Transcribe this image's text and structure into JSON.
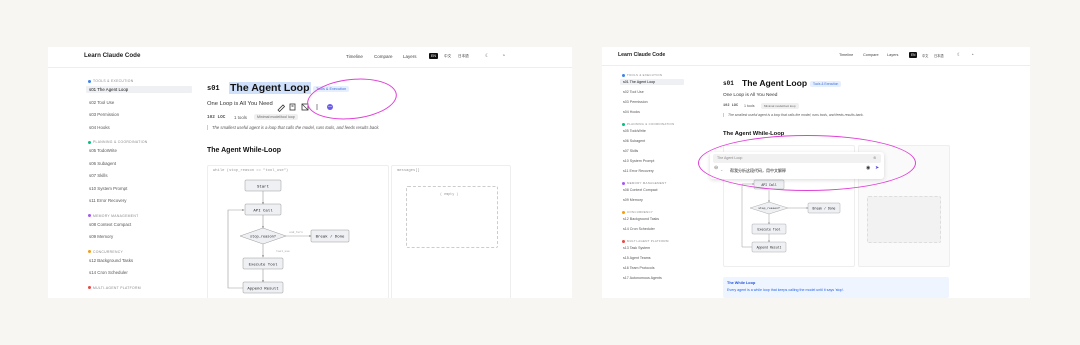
{
  "left": {
    "header": {
      "brand": "Learn Claude Code",
      "nav": [
        "Timeline",
        "Compare",
        "Layers"
      ],
      "langs": [
        "EN",
        "中文",
        "日本語"
      ],
      "active_lang": "EN",
      "icons": [
        "moon-icon",
        "github-icon"
      ]
    },
    "sidebar": [
      {
        "section": "TOOLS & EXECUTION",
        "color": "#3b82f6",
        "items": [
          {
            "label": "s01 The Agent Loop",
            "active": true
          },
          {
            "label": "s02 Tool Use"
          },
          {
            "label": "s03 Permission"
          },
          {
            "label": "s04 Hooks"
          }
        ]
      },
      {
        "section": "PLANNING & COORDINATION",
        "color": "#10b981",
        "items": [
          {
            "label": "s05 TodoWrite"
          },
          {
            "label": "s06 Subagent"
          },
          {
            "label": "s07 Skills"
          },
          {
            "label": "s10 System Prompt"
          },
          {
            "label": "s11 Error Recovery"
          }
        ]
      },
      {
        "section": "MEMORY MANAGEMENT",
        "color": "#a855f7",
        "items": [
          {
            "label": "s08 Context Compact"
          },
          {
            "label": "s09 Memory"
          }
        ]
      },
      {
        "section": "CONCURRENCY",
        "color": "#f59e0b",
        "items": [
          {
            "label": "s12 Background Tasks"
          },
          {
            "label": "s14 Cron Scheduler"
          }
        ]
      },
      {
        "section": "MULTI-AGENT PLATFORM",
        "color": "#ef4444",
        "items": []
      }
    ],
    "main": {
      "code": "s01",
      "title": "The Agent Loop",
      "badge": "Tools & Execution",
      "subtitle": "One Loop is All You Need",
      "loc": "102 LOC",
      "tools": "1 tools",
      "pill": "Minimal model/tool loop",
      "quote": "The smallest useful agent is a loop that calls the model, runs tools, and feeds results back.",
      "section_title": "The Agent While-Loop",
      "code_caption": "while (stop_reason == \"tool_use\")",
      "messages_caption": "messages[]",
      "empty_text": "( empty )",
      "toolbar_icons": [
        "pencil-icon",
        "copy-icon",
        "screenshot-icon",
        "more-icon",
        "assistant-icon"
      ]
    },
    "flow": {
      "nodes": [
        "Start",
        "API Call",
        "stop_reason?",
        "Break / Done",
        "Execute Tool",
        "Append Result"
      ],
      "edge_labels": [
        "end_turn",
        "tool_use"
      ]
    }
  },
  "right": {
    "header": {
      "brand": "Learn Claude Code",
      "nav": [
        "Timeline",
        "Compare",
        "Layers"
      ],
      "langs": [
        "EN",
        "中文",
        "日本語"
      ],
      "active_lang": "EN"
    },
    "sidebar": [
      {
        "section": "TOOLS & EXECUTION",
        "color": "#3b82f6",
        "items": [
          {
            "label": "s01 The Agent Loop",
            "active": true
          },
          {
            "label": "s02 Tool Use"
          },
          {
            "label": "s03 Permission"
          },
          {
            "label": "s04 Hooks"
          }
        ]
      },
      {
        "section": "PLANNING & COORDINATION",
        "color": "#10b981",
        "items": [
          {
            "label": "s05 TodoWrite"
          },
          {
            "label": "s06 Subagent"
          },
          {
            "label": "s07 Skills"
          },
          {
            "label": "s10 System Prompt"
          },
          {
            "label": "s11 Error Recovery"
          }
        ]
      },
      {
        "section": "MEMORY MANAGEMENT",
        "color": "#a855f7",
        "items": [
          {
            "label": "s08 Context Compact"
          },
          {
            "label": "s09 Memory"
          }
        ]
      },
      {
        "section": "CONCURRENCY",
        "color": "#f59e0b",
        "items": [
          {
            "label": "s12 Background Tasks"
          },
          {
            "label": "s14 Cron Scheduler"
          }
        ]
      },
      {
        "section": "MULTI-AGENT PLATFORM",
        "color": "#ef4444",
        "items": [
          {
            "label": "s13 Task System"
          },
          {
            "label": "s15 Agent Teams"
          },
          {
            "label": "s16 Team Protocols"
          },
          {
            "label": "s17 Autonomous Agents"
          }
        ]
      }
    ],
    "main": {
      "code": "s01",
      "title": "The Agent Loop",
      "badge": "Tools & Execution",
      "subtitle": "One Loop is All You Need",
      "loc": "102 LOC",
      "tools": "1 tools",
      "pill": "Minimal model/tool loop",
      "quote": "The smallest useful agent is a loop that calls the model, runs tools, and feeds results back.",
      "section_title": "The Agent While-Loop",
      "chat_quote": "The Agent Loop",
      "chat_input": "帮我分析这段代码，用中文解释",
      "info_title": "The While Loop",
      "info_text": "Every agent is a while loop that keeps calling the model until it says 'stop'."
    },
    "flow": {
      "nodes": [
        "API Call",
        "stop_reason?",
        "Break / Done",
        "Execute Tool",
        "Append Result"
      ]
    }
  },
  "highlight_color": "#e040d8"
}
